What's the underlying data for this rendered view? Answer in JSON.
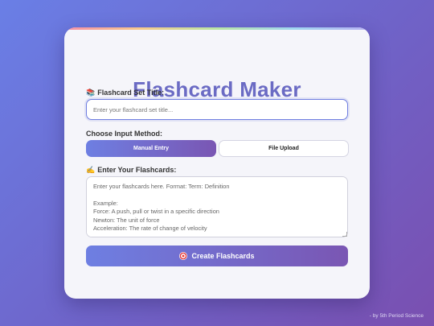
{
  "app": {
    "title": "Flashcard Maker"
  },
  "set_title": {
    "emoji": "📚",
    "label": "Flashcard Set Title:",
    "placeholder": "Enter your flashcard set title..."
  },
  "input_method": {
    "label": "Choose Input Method:",
    "options": [
      "Manual Entry",
      "File Upload"
    ],
    "selected": "Manual Entry"
  },
  "cards": {
    "emoji": "✍️",
    "label": "Enter Your Flashcards:",
    "placeholder": "Enter your flashcards here. Format: Term: Definition\n\nExample:\nForce: A push, pull or twist in a specific direction\nNewton: The unit of force\nAcceleration: The rate of change of velocity"
  },
  "create_button": {
    "icon": "target-icon",
    "label": "Create Flashcards"
  },
  "footer": {
    "credit": "- by 5th Period Science"
  },
  "colors": {
    "accent_start": "#6e7fe2",
    "accent_end": "#7a56b3",
    "title": "#6b6bc4"
  }
}
